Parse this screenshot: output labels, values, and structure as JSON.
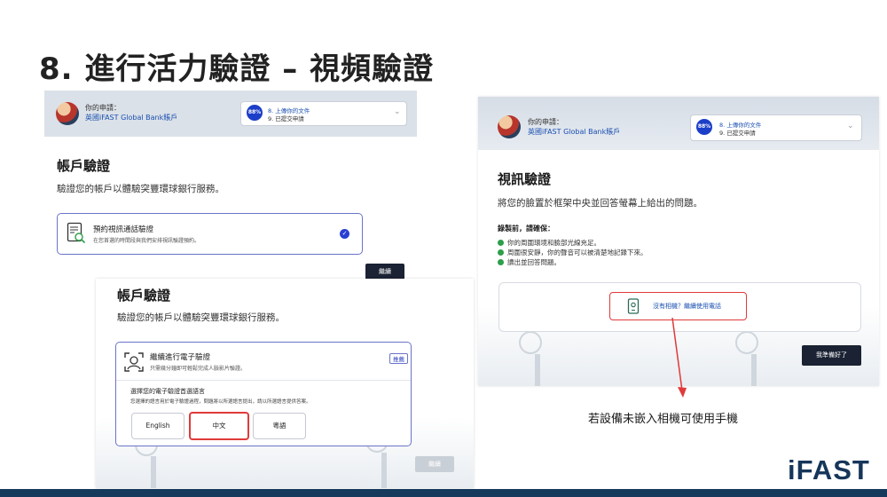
{
  "slide": {
    "title": "8. 進行活力驗證 – 視頻驗證",
    "caption": "若設備未嵌入相機可使用手機",
    "brand": "iFAST"
  },
  "app_header": {
    "label": "你的申請：",
    "account": "英國iFAST Global Bank賬戶",
    "progress_percent": "88%",
    "step_current": "8. 上傳你的文件",
    "step_next": "9. 已提交申請"
  },
  "panel_account": {
    "title": "帳戶驗證",
    "subtitle": "驗證您的帳戶以體驗突豐環球銀行服務。",
    "option_title": "預約視訊通話驗證",
    "option_desc": "在您首選的時間段與我們安排視訊驗證預約。",
    "next_button": "繼續"
  },
  "panel_electronic": {
    "title": "帳戶驗證",
    "subtitle": "驗證您的帳戶以體驗突豐環球銀行服務。",
    "option_title": "繼續進行電子驗證",
    "option_desc": "只需幾分鐘即可輕鬆完成人臉影片驗證。",
    "tag": "推薦",
    "language_heading": "選擇您的電子驗證首選語言",
    "language_desc": "您選擇的語言用於電子驗證過程，問題將以所選語言提出，請以所選語言提供答案。",
    "languages": [
      "English",
      "中文",
      "粵語"
    ],
    "selected_language": "中文",
    "next_button": "繼續"
  },
  "panel_video": {
    "title": "視訊驗證",
    "subtitle": "將您的臉置於框架中央並回答螢幕上給出的問題。",
    "checklist_heading": "錄製前，請確保：",
    "checklist": [
      "你的周圍環境和臉部光線充足。",
      "周圍很安靜，你的聲音可以被清楚地記錄下來。",
      "讀出並回答問題。"
    ],
    "phone_link": "沒有相機？繼續使用電話",
    "ready_button": "我準備好了"
  },
  "colors": {
    "accent": "#1c3fc9",
    "highlight": "#e03a3a",
    "dark_button": "#1a2233",
    "brand": "#16365a"
  }
}
